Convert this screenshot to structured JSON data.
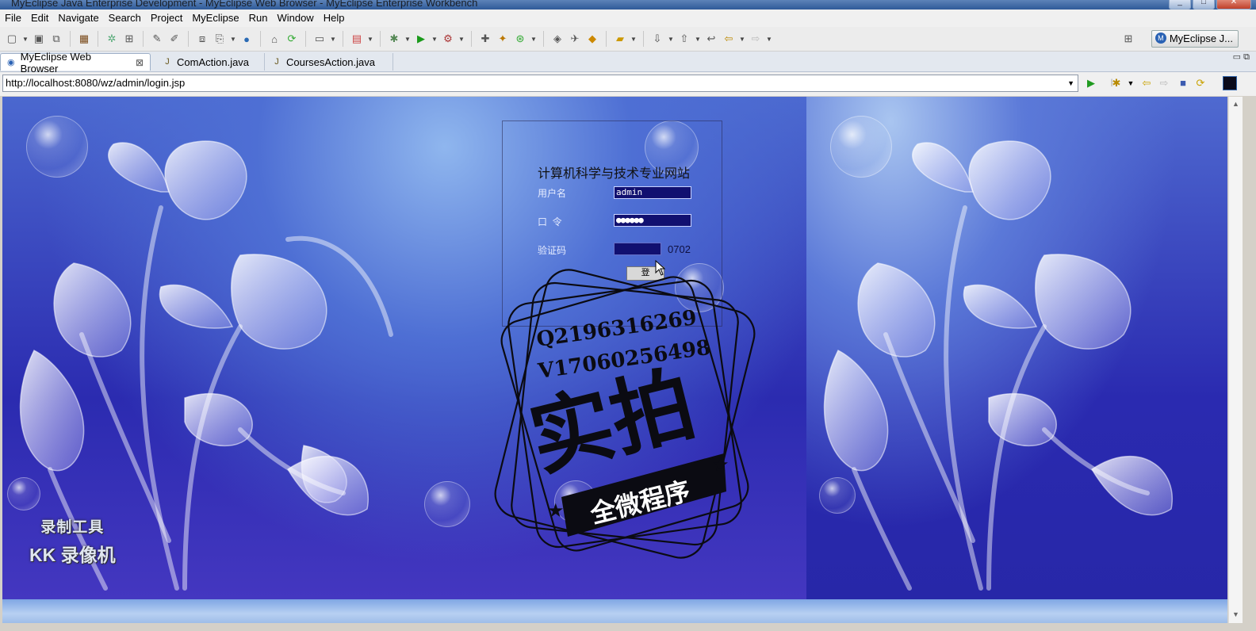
{
  "window": {
    "title": "MyEclipse Java Enterprise Development - MyEclipse Web Browser - MyEclipse Enterprise Workbench"
  },
  "menu": [
    "File",
    "Edit",
    "Navigate",
    "Search",
    "Project",
    "MyEclipse",
    "Run",
    "Window",
    "Help"
  ],
  "toolbar": {
    "perspective_label": "MyEclipse J..."
  },
  "tabs": [
    {
      "label": "MyEclipse Web Browser",
      "active": true,
      "closable": true
    },
    {
      "label": "ComAction.java",
      "active": false
    },
    {
      "label": "CoursesAction.java",
      "active": false
    }
  ],
  "address": {
    "url": "http://localhost:8080/wz/admin/login.jsp"
  },
  "login": {
    "site_title": "计算机科学与技术专业网站",
    "username_label": "用户名",
    "username_value": "admin",
    "password_label": "口  令",
    "password_value": "●●●●●●",
    "captcha_label": "验证码",
    "captcha_value": "0702",
    "submit_label": "登"
  },
  "watermark": {
    "line1": "Q2196316269",
    "line2": "V17060256498",
    "main_text": "实拍",
    "banner": "全微程序"
  },
  "recorder": {
    "line1": "录制工具",
    "line2": "KK 录像机"
  }
}
